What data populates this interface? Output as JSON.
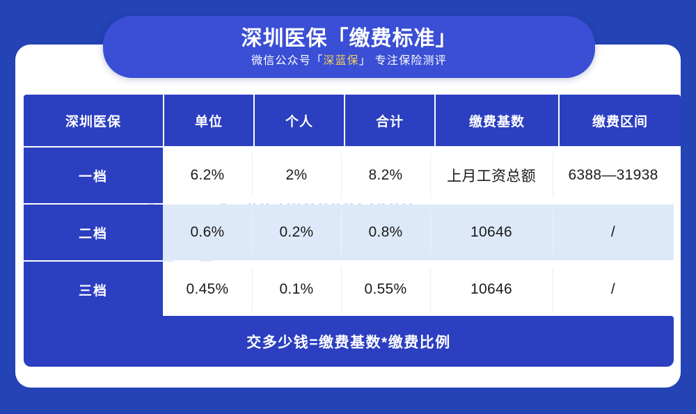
{
  "header": {
    "main_title": "深圳医保「缴费标准」",
    "subtitle_prefix": "微信公众号「",
    "subtitle_brand": "深蓝保",
    "subtitle_suffix": "」 专注保险测评",
    "pill_color": "#3a4fd5",
    "brand_color": "#f2d05a"
  },
  "watermark": {
    "domain": "shenlanbao.com",
    "slogan": "中立丨专业丨诚信",
    "logo_text": "深蓝保",
    "color": "#ccd9ef"
  },
  "table": {
    "columns": [
      "深圳医保",
      "单位",
      "个人",
      "合计",
      "缴费基数",
      "缴费区间"
    ],
    "rows": [
      {
        "tier": "一档",
        "unit": "6.2%",
        "individual": "2%",
        "total": "8.2%",
        "base": "上月工资总额",
        "range": "6388—31938",
        "striped": false
      },
      {
        "tier": "二档",
        "unit": "0.6%",
        "individual": "0.2%",
        "total": "0.8%",
        "base": "10646",
        "range": "/",
        "striped": true
      },
      {
        "tier": "三档",
        "unit": "0.45%",
        "individual": "0.1%",
        "total": "0.55%",
        "base": "10646",
        "range": "/",
        "striped": false
      }
    ],
    "footer_note": "交多少钱=缴费基数*缴费比例",
    "header_bg": "#2b3fc0",
    "stripe_bg": "#dde9f8",
    "page_bg": "#2443b4"
  }
}
